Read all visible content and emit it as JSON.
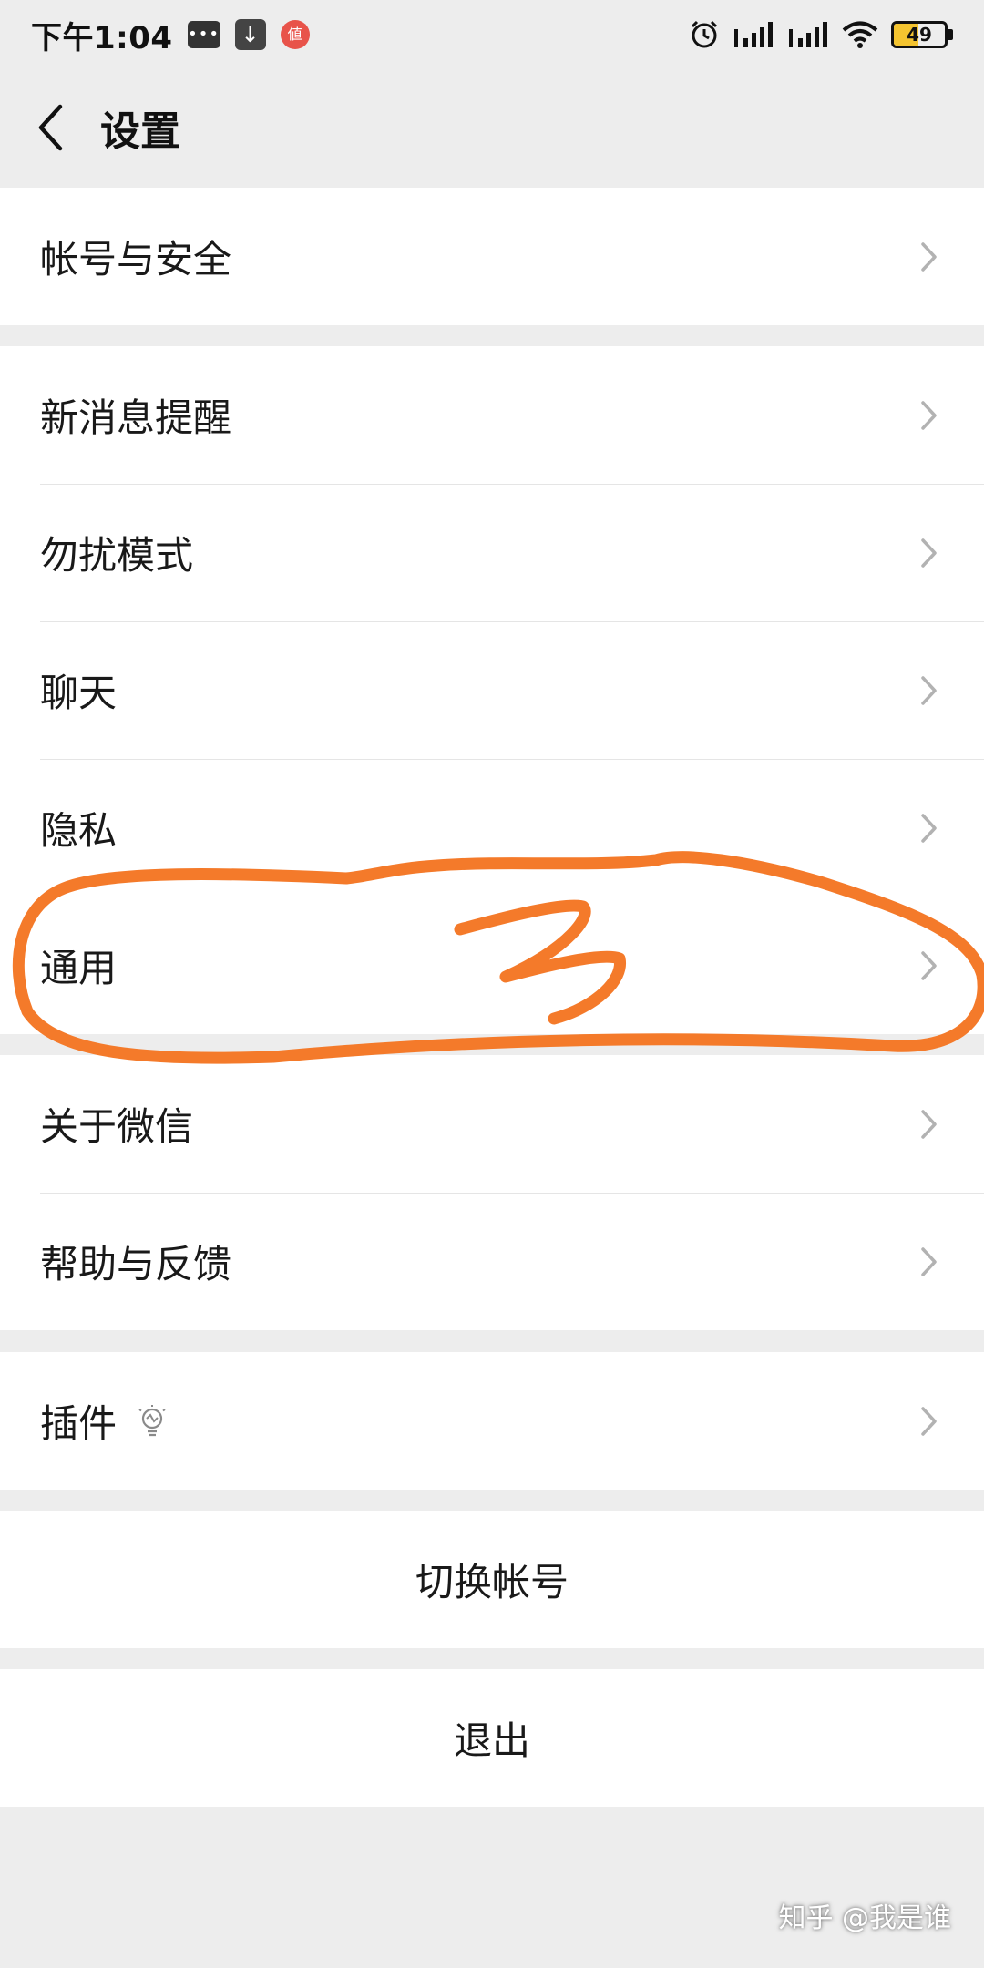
{
  "status_bar": {
    "time": "下午1:04",
    "battery_level": "49",
    "battery_fill_percent": 49
  },
  "header": {
    "title": "设置"
  },
  "groups": {
    "account": {
      "label": "帐号与安全"
    },
    "notify": {
      "label": "新消息提醒"
    },
    "dnd": {
      "label": "勿扰模式"
    },
    "chat": {
      "label": "聊天"
    },
    "privacy": {
      "label": "隐私"
    },
    "general": {
      "label": "通用"
    },
    "about": {
      "label": "关于微信"
    },
    "help": {
      "label": "帮助与反馈"
    },
    "plugins": {
      "label": "插件"
    }
  },
  "actions": {
    "switch_account": "切换帐号",
    "logout": "退出"
  },
  "watermark": "知乎 @我是谁",
  "annotation": {
    "text": "3",
    "color": "#f47a2a"
  }
}
